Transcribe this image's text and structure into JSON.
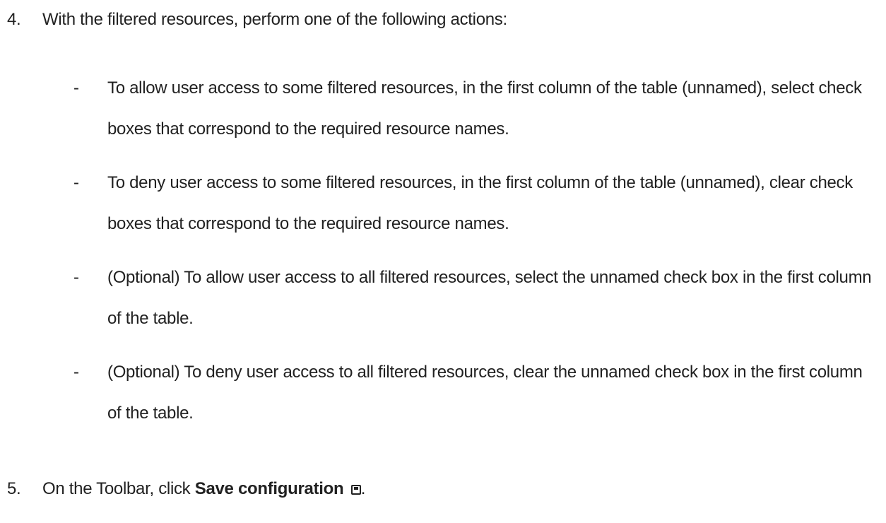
{
  "step4": {
    "number": "4.",
    "text": "With the filtered resources, perform one of the following actions:"
  },
  "bullets": [
    {
      "marker": "-",
      "text": "To allow user access to some filtered resources, in the first column of the table (unnamed), select check boxes that correspond to the required resource names."
    },
    {
      "marker": "-",
      "text": "To deny user access to some filtered resources, in the first column of the table (unnamed), clear check boxes that correspond to the required resource names."
    },
    {
      "marker": "-",
      "text": "(Optional) To allow user access to all filtered resources, select the unnamed check box in the first column of the table."
    },
    {
      "marker": "-",
      "text": "(Optional) To deny user access to all filtered resources, clear the unnamed check box in the first column of the table."
    }
  ],
  "step5": {
    "number": "5.",
    "prefix": "On the Toolbar, click ",
    "bold": "Save configuration",
    "icon": "save-icon",
    "suffix": "."
  }
}
